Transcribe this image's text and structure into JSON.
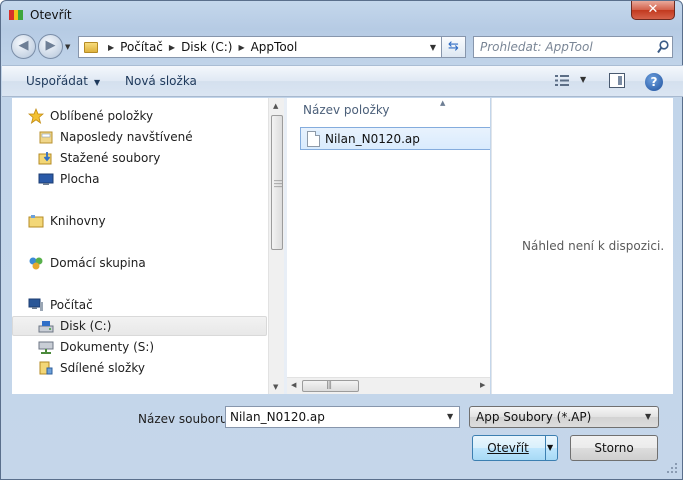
{
  "window": {
    "title": "Otevřít",
    "close_label": "✕"
  },
  "navigation": {
    "back_icon": "back-arrow-icon",
    "forward_icon": "forward-arrow-icon",
    "breadcrumbs": [
      "Počítač",
      "Disk (C:)",
      "AppTool"
    ],
    "search_placeholder": "Prohledat: AppTool"
  },
  "toolbar": {
    "organize_label": "Uspořádat",
    "new_folder_label": "Nová složka"
  },
  "sidebar": {
    "items": [
      {
        "label": "Oblíbené položky",
        "icon": "star-icon"
      },
      {
        "label": "Naposledy navštívené",
        "icon": "recent-places-icon"
      },
      {
        "label": "Stažené soubory",
        "icon": "downloads-folder-icon"
      },
      {
        "label": "Plocha",
        "icon": "desktop-icon"
      },
      {
        "label": "Knihovny",
        "icon": "libraries-icon"
      },
      {
        "label": "Domácí skupina",
        "icon": "homegroup-icon"
      },
      {
        "label": "Počítač",
        "icon": "computer-icon"
      },
      {
        "label": "Disk (C:)",
        "icon": "local-disk-icon",
        "selected": true
      },
      {
        "label": "Dokumenty (S:)",
        "icon": "network-drive-icon"
      },
      {
        "label": "Sdílené složky",
        "icon": "shared-folder-icon"
      }
    ]
  },
  "file_list": {
    "column_header": "Název položky",
    "files": [
      {
        "name": "Nilan_N0120.ap",
        "selected": true
      }
    ]
  },
  "preview": {
    "message": "Náhled není k dispozici."
  },
  "footer": {
    "filename_label": "Název souboru:",
    "filename_value": "Nilan_N0120.ap",
    "filetype_value": "App Soubory (*.AP)",
    "open_label": "Otevřít",
    "cancel_label": "Storno"
  }
}
